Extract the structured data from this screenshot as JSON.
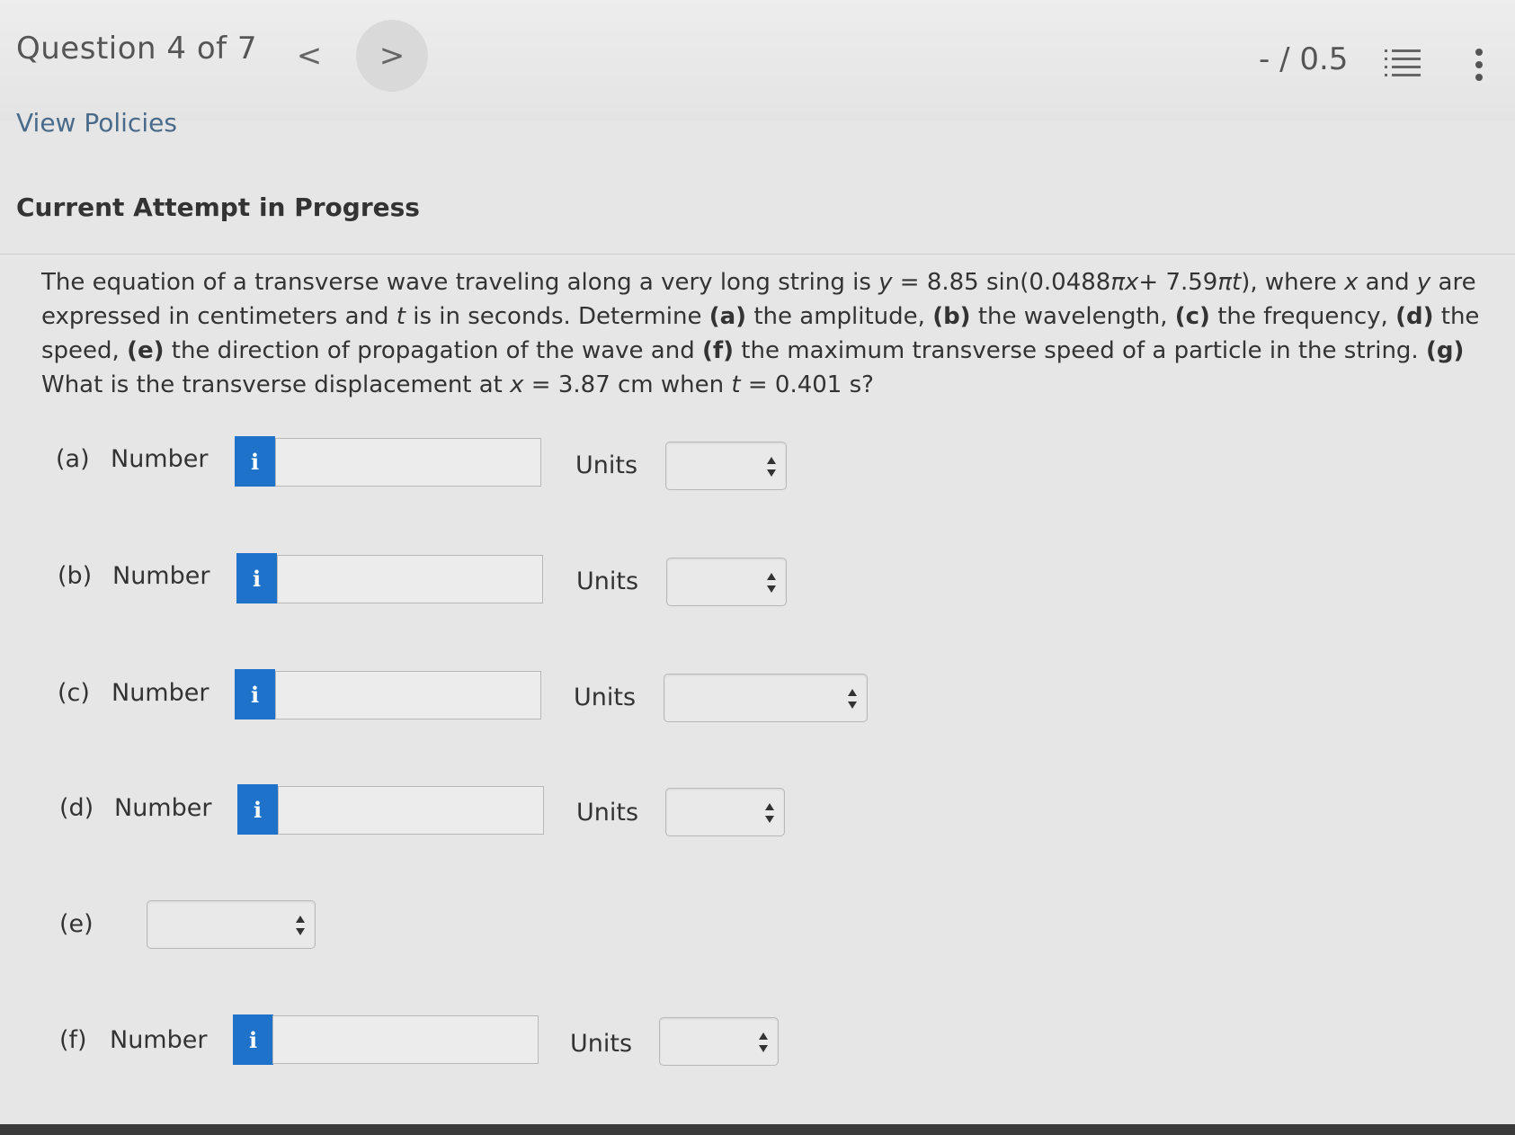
{
  "header": {
    "question_title": "Question 4 of 7",
    "prev_symbol": "<",
    "next_symbol": ">",
    "score": "- / 0.5"
  },
  "links": {
    "view_policies": "View Policies"
  },
  "status": {
    "attempt": "Current Attempt in Progress"
  },
  "question": {
    "s1": "The equation of a transverse wave traveling along a very long string is ",
    "y": "y",
    "s2": " = 8.85 sin(0.0488",
    "pi1": "πx",
    "s3": "+ 7.59",
    "pi2": "πt",
    "s4": "), where ",
    "x": "x",
    "s5": " and ",
    "y2": "y",
    "s6": " are expressed in centimeters and ",
    "t": "t",
    "s7": " is in seconds. Determine ",
    "a": "(a)",
    "s8": " the amplitude, ",
    "b": "(b)",
    "s9": " the wavelength, ",
    "c": "(c)",
    "s10": " the frequency, ",
    "d": "(d)",
    "s11": " the speed, ",
    "e": "(e)",
    "s12": " the direction of propagation of the wave and ",
    "f": "(f)",
    "s13": " the maximum transverse speed of a particle in the string. ",
    "g": "(g)",
    "s14": " What is the transverse displacement at ",
    "x2": "x",
    "s15": " = 3.87 cm when ",
    "t2": "t",
    "s16": " = 0.401 s?"
  },
  "parts": {
    "a": {
      "label": "(a)",
      "number_label": "Number",
      "info": "i",
      "value": "",
      "units_label": "Units",
      "units_selected": ""
    },
    "b": {
      "label": "(b)",
      "number_label": "Number",
      "info": "i",
      "value": "",
      "units_label": "Units",
      "units_selected": ""
    },
    "c": {
      "label": "(c)",
      "number_label": "Number",
      "info": "i",
      "value": "",
      "units_label": "Units",
      "units_selected": ""
    },
    "d": {
      "label": "(d)",
      "number_label": "Number",
      "info": "i",
      "value": "",
      "units_label": "Units",
      "units_selected": ""
    },
    "e": {
      "label": "(e)",
      "selected": ""
    },
    "f": {
      "label": "(f)",
      "number_label": "Number",
      "info": "i",
      "value": "",
      "units_label": "Units",
      "units_selected": ""
    }
  },
  "colors": {
    "info_button": "#1f72c9",
    "link": "#4a6a8a"
  }
}
